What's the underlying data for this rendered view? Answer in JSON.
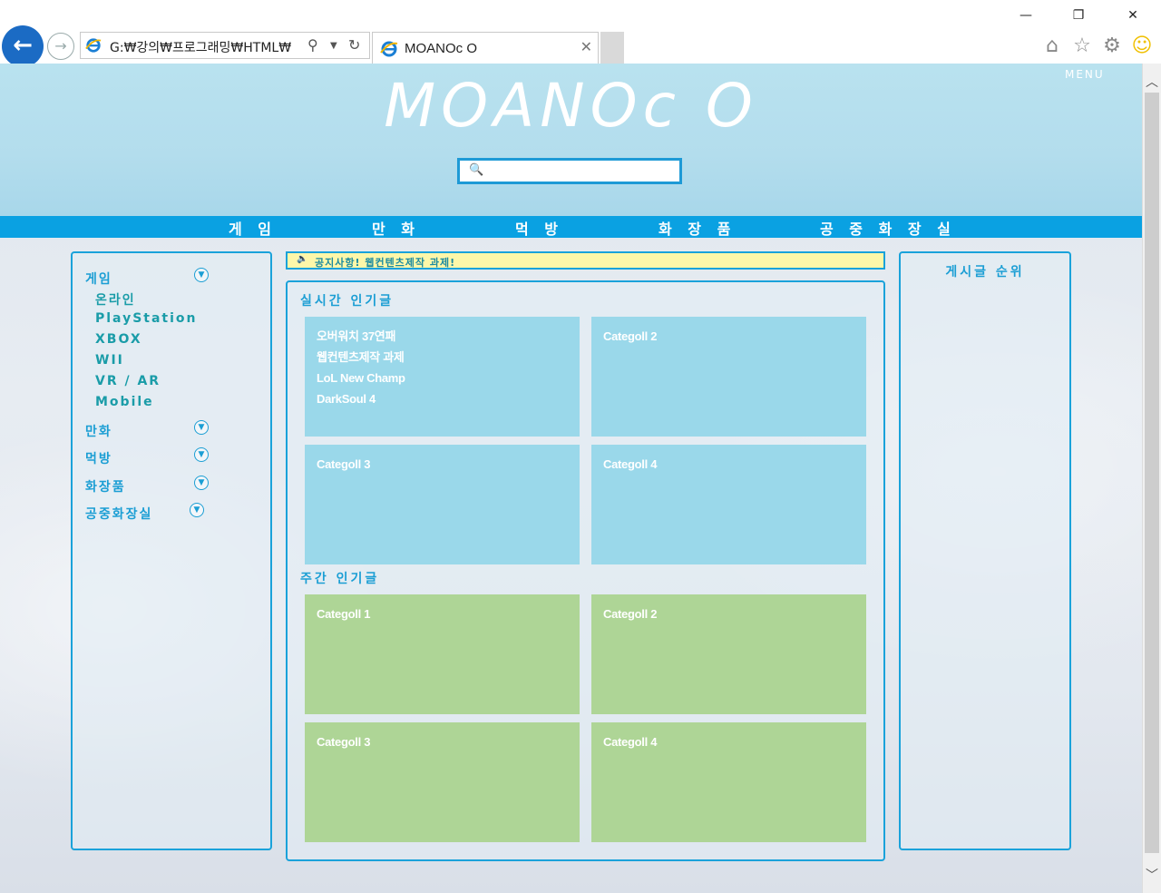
{
  "browser": {
    "address": "G:₩강의₩프로그래밍₩HTML₩",
    "tab_title": "MOANOc O",
    "icons": [
      "back-arrow-icon",
      "forward-arrow-icon",
      "ie-icon",
      "search-icon",
      "dropdown-icon",
      "refresh-icon",
      "close-tab-icon",
      "home-icon",
      "star-icon",
      "gear-icon",
      "smiley-icon"
    ]
  },
  "header": {
    "menu_label": "MENU",
    "logo": "MOANOc O"
  },
  "nav": {
    "items": [
      {
        "label": "게 임"
      },
      {
        "label": "만 화"
      },
      {
        "label": "먹 방"
      },
      {
        "label": "화 장 품"
      },
      {
        "label": "공 중 화 장 실"
      }
    ]
  },
  "sidebar": {
    "categories": [
      {
        "label": "게임"
      },
      {
        "label": "만화"
      },
      {
        "label": "먹방"
      },
      {
        "label": "화장품"
      },
      {
        "label": "공중화장실"
      }
    ],
    "game_sub": [
      {
        "label": "온라인"
      },
      {
        "label": "PlayStation"
      },
      {
        "label": "XBOX"
      },
      {
        "label": "WII"
      },
      {
        "label": "VR / AR"
      },
      {
        "label": "Mobile"
      }
    ]
  },
  "notice": {
    "text": "공지사항! 웹컨텐츠제작 과제!"
  },
  "main": {
    "realtime_title": "실시간 인기글",
    "weekly_title": "주간 인기글",
    "realtime_cards": [
      {
        "lines": [
          "오버워치 37연패",
          "웹컨텐츠제작 과제",
          "LoL New Champ",
          "DarkSoul 4"
        ]
      },
      {
        "lines": [
          "Categoll 2"
        ]
      },
      {
        "lines": [
          "Categoll 3"
        ]
      },
      {
        "lines": [
          "Categoll 4"
        ]
      }
    ],
    "weekly_cards": [
      {
        "lines": [
          "Categoll 1"
        ]
      },
      {
        "lines": [
          "Categoll 2"
        ]
      },
      {
        "lines": [
          "Categoll 3"
        ]
      },
      {
        "lines": [
          "Categoll 4"
        ]
      }
    ]
  },
  "ranking": {
    "title": "게시글 순위"
  },
  "colors": {
    "accent": "#0aa1e2",
    "card_blue": "#9ad8ea",
    "card_green": "#aed596",
    "notice_bg": "#fdf7a9"
  }
}
